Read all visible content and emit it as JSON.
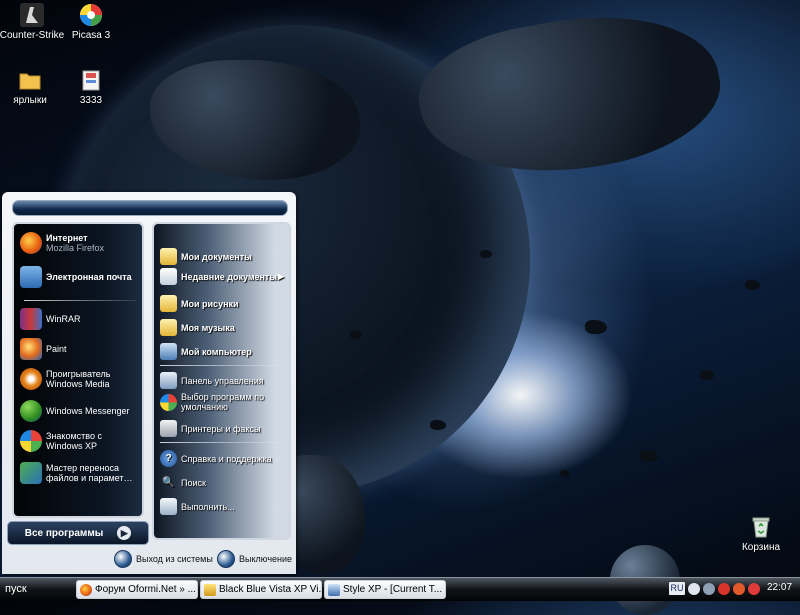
{
  "desktop": {
    "icons": [
      {
        "label": "Counter-Strike",
        "icon": "counter-strike-icon"
      },
      {
        "label": "Picasa 3",
        "icon": "picasa-icon"
      },
      {
        "label": "ярлыки",
        "icon": "folder-icon"
      },
      {
        "label": "3333",
        "icon": "archive-icon"
      },
      {
        "label": "Корзина",
        "icon": "recycle-bin-icon"
      }
    ]
  },
  "start_menu": {
    "left": [
      {
        "title": "Интернет",
        "subtitle": "Mozilla Firefox",
        "icon": "firefox-icon",
        "bold": true
      },
      {
        "title": "Электронная почта",
        "subtitle": "",
        "icon": "email-icon",
        "bold": true
      },
      {
        "title": "WinRAR",
        "icon": "winrar-icon"
      },
      {
        "title": "Paint",
        "icon": "paint-icon"
      },
      {
        "title": "Проигрыватель Windows Media",
        "icon": "media-player-icon"
      },
      {
        "title": "Windows Messenger",
        "icon": "messenger-icon"
      },
      {
        "title": "Знакомство с Windows XP",
        "icon": "tour-icon"
      },
      {
        "title": "Мастер переноса файлов и парамет…",
        "icon": "transfer-wizard-icon"
      }
    ],
    "right": [
      {
        "label": "Мои документы",
        "icon": "my-documents-icon",
        "bold": true
      },
      {
        "label": "Недавние документы",
        "icon": "recent-documents-icon",
        "bold": true,
        "submenu": true
      },
      {
        "label": "Мои рисунки",
        "icon": "my-pictures-icon",
        "bold": true
      },
      {
        "label": "Моя музыка",
        "icon": "my-music-icon",
        "bold": true
      },
      {
        "label": "Мой компьютер",
        "icon": "my-computer-icon",
        "bold": true
      },
      {
        "label": "Панель управления",
        "icon": "control-panel-icon"
      },
      {
        "label": "Выбор программ по умолчанию",
        "icon": "default-programs-icon"
      },
      {
        "label": "Принтеры и факсы",
        "icon": "printers-icon"
      },
      {
        "label": "Справка и поддержка",
        "icon": "help-icon"
      },
      {
        "label": "Поиск",
        "icon": "search-icon"
      },
      {
        "label": "Выполнить...",
        "icon": "run-icon"
      }
    ],
    "all_programs": "Все программы",
    "logoff": "Выход из системы",
    "shutdown": "Выключение"
  },
  "taskbar": {
    "start_label": "пуск",
    "tasks": [
      {
        "label": "Форум Oformi.Net » ...",
        "icon": "firefox-icon"
      },
      {
        "label": "Black Blue Vista XP Vi...",
        "icon": "folder-icon"
      },
      {
        "label": "Style XP - [Current T...",
        "icon": "style-xp-icon"
      }
    ],
    "language": "RU",
    "clock": "22:07"
  }
}
